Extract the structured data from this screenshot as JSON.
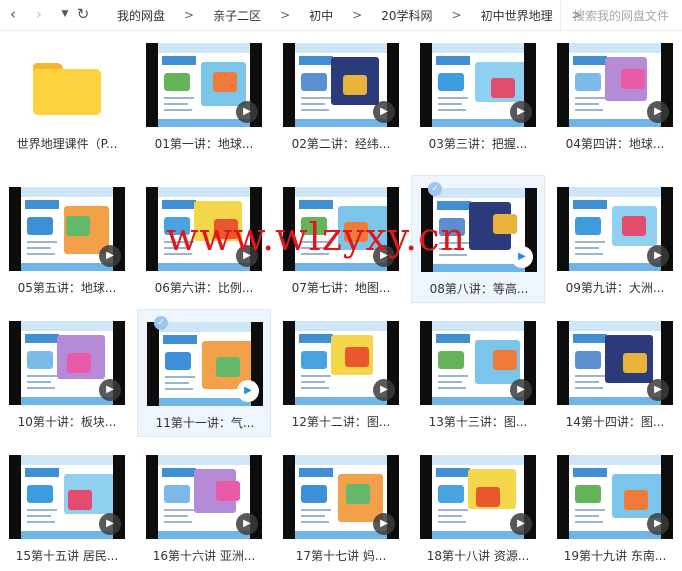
{
  "toolbar": {
    "back_icon": "chevron-left-icon",
    "forward_icon": "chevron-right-icon",
    "history_icon": "caret-down-icon",
    "refresh_icon": "refresh-icon",
    "breadcrumb": [
      "我的网盘",
      "亲子二区",
      "初中",
      "20学科网",
      "初中世界地理"
    ],
    "separator": ">",
    "search_placeholder": "搜索我的网盘文件"
  },
  "watermark": "www.wlzyxy.cn",
  "files": [
    {
      "name": "世界地理课件（P...",
      "type": "folder",
      "icon": "folder-icon",
      "selected": false
    },
    {
      "name": "01第一讲：地球...",
      "type": "video",
      "selected": false
    },
    {
      "name": "02第二讲：经纬...",
      "type": "video",
      "selected": false
    },
    {
      "name": "03第三讲：把握...",
      "type": "video",
      "selected": false
    },
    {
      "name": "04第四讲：地球...",
      "type": "video",
      "selected": false
    },
    {
      "name": "05第五讲：地球...",
      "type": "video",
      "selected": false
    },
    {
      "name": "06第六讲：比例...",
      "type": "video",
      "selected": false
    },
    {
      "name": "07第七讲：地图...",
      "type": "video",
      "selected": false
    },
    {
      "name": "08第八讲：等高...",
      "type": "video",
      "selected": true
    },
    {
      "name": "09第九讲：大洲...",
      "type": "video",
      "selected": false
    },
    {
      "name": "10第十讲：板块...",
      "type": "video",
      "selected": false
    },
    {
      "name": "11第十一讲：气...",
      "type": "video",
      "selected": true
    },
    {
      "name": "12第十二讲：图...",
      "type": "video",
      "selected": false
    },
    {
      "name": "13第十三讲：图...",
      "type": "video",
      "selected": false
    },
    {
      "name": "14第十四讲：图...",
      "type": "video",
      "selected": false
    },
    {
      "name": "15第十五讲 居民...",
      "type": "video",
      "selected": false
    },
    {
      "name": "16第十六讲 亚洲...",
      "type": "video",
      "selected": false
    },
    {
      "name": "17第十七讲 妈...",
      "type": "video",
      "selected": false
    },
    {
      "name": "18第十八讲 资源...",
      "type": "video",
      "selected": false
    },
    {
      "name": "19第十九讲 东南...",
      "type": "video",
      "selected": false
    }
  ],
  "colors": {
    "folder": "#fcd23f",
    "selected_bg": "#eef5fc",
    "watermark": "#e0161b",
    "play_selected": "#1f8cf0"
  }
}
